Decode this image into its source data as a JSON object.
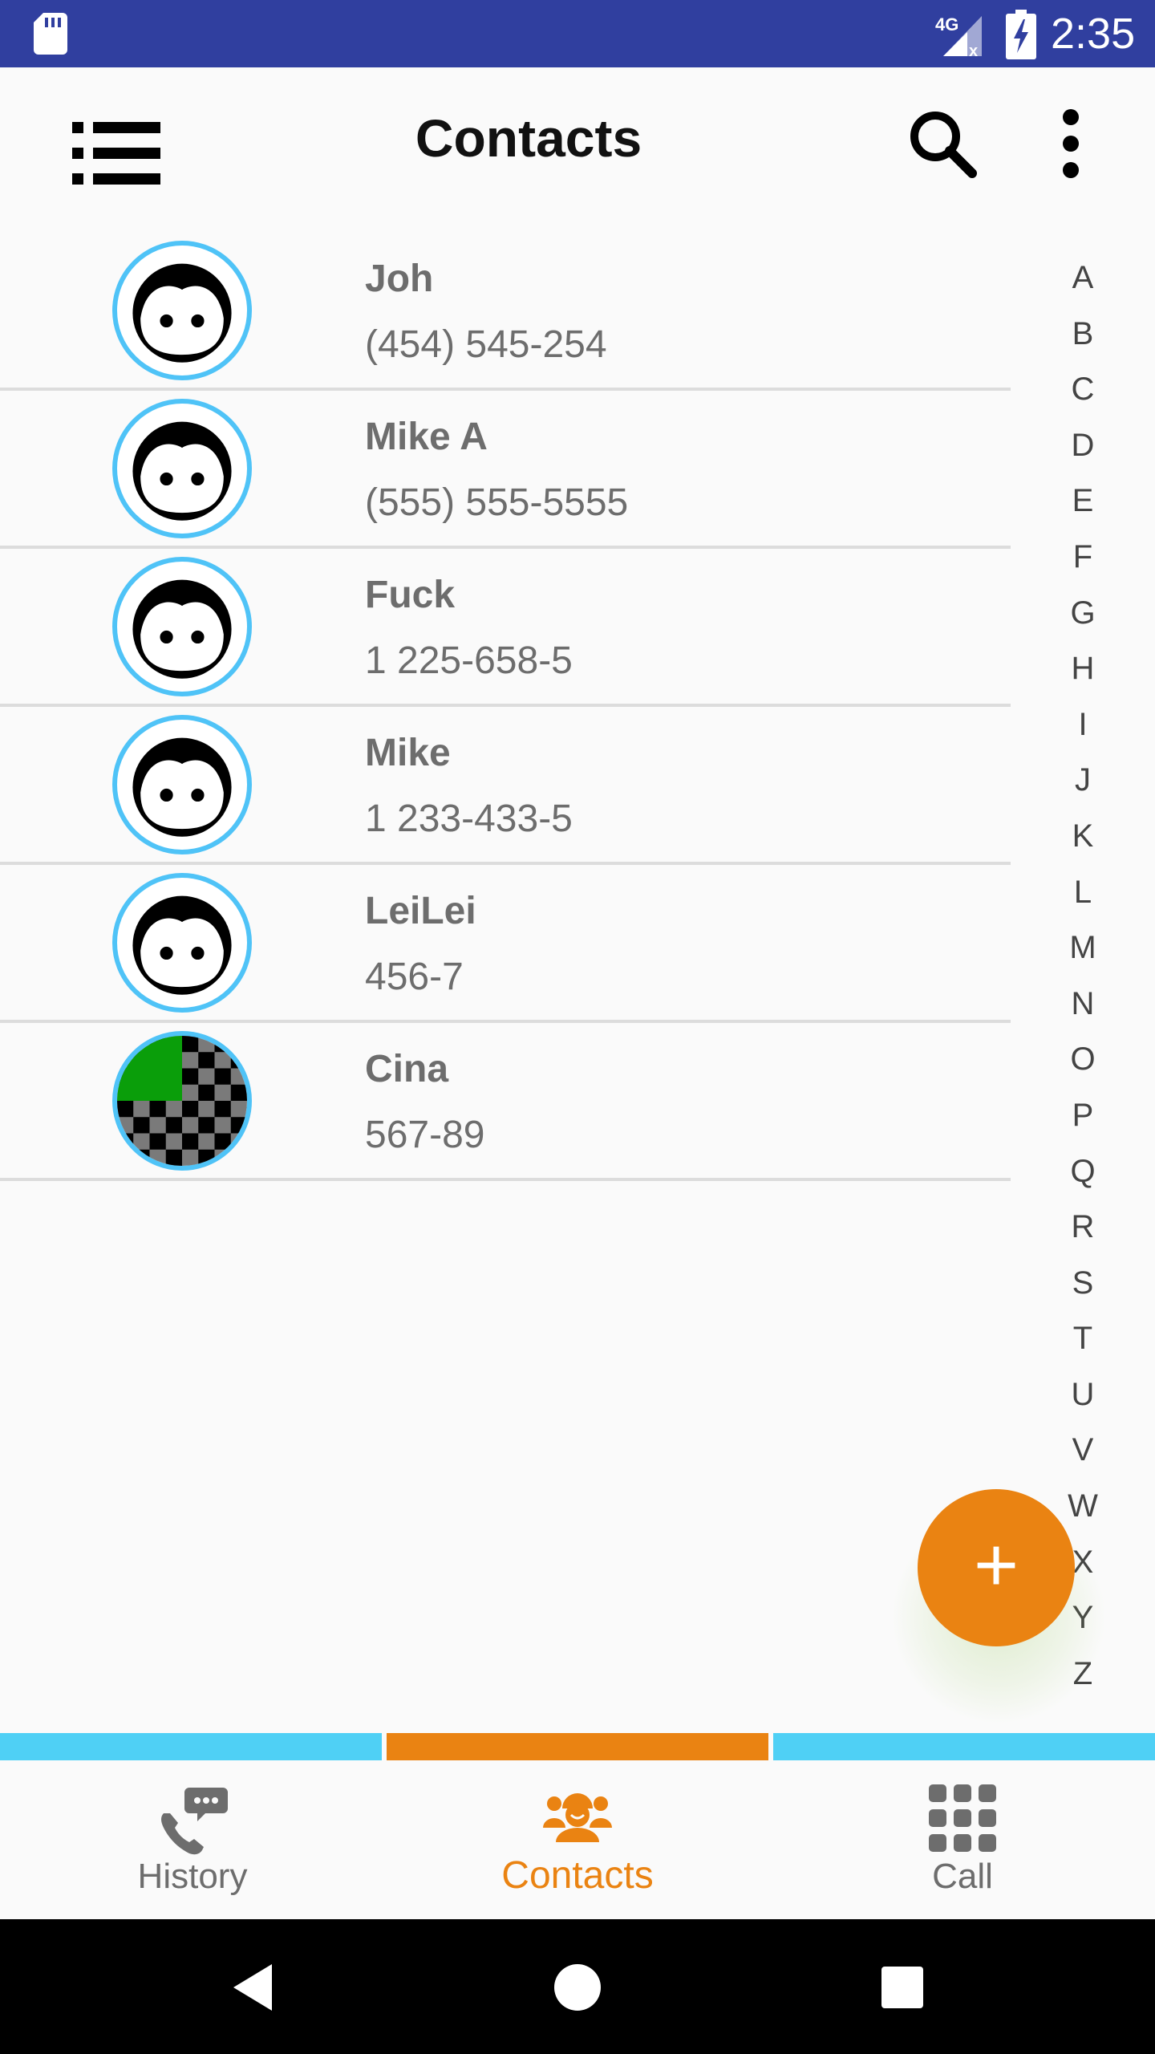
{
  "status_bar": {
    "time": "2:35",
    "network": "4G",
    "icons": [
      "sd-card-icon",
      "signal-icon",
      "battery-charging-icon"
    ]
  },
  "app_bar": {
    "title": "Contacts",
    "icons": [
      "menu-list-icon",
      "search-icon",
      "more-vert-icon"
    ]
  },
  "contacts": [
    {
      "name": "Joh",
      "phone": "(454) 545-254",
      "avatar": "face-icon"
    },
    {
      "name": "Mike A",
      "phone": "(555) 555-5555",
      "avatar": "face-icon"
    },
    {
      "name": "Fuck",
      "phone": "1 225-658-5",
      "avatar": "face-icon"
    },
    {
      "name": "Mike",
      "phone": "1 233-433-5",
      "avatar": "face-icon"
    },
    {
      "name": "LeiLei",
      "phone": "456-7",
      "avatar": "face-icon"
    },
    {
      "name": "Cina",
      "phone": "567-89",
      "avatar": "checker-image"
    }
  ],
  "alphabet": [
    "A",
    "B",
    "C",
    "D",
    "E",
    "F",
    "G",
    "H",
    "I",
    "J",
    "K",
    "L",
    "M",
    "N",
    "O",
    "P",
    "Q",
    "R",
    "S",
    "T",
    "U",
    "V",
    "W",
    "X",
    "Y",
    "Z"
  ],
  "fab": {
    "label": "+"
  },
  "bottom_nav": {
    "tabs": [
      {
        "label": "History",
        "icon": "phone-chat-icon",
        "active": false
      },
      {
        "label": "Contacts",
        "icon": "group-icon",
        "active": true
      },
      {
        "label": "Call",
        "icon": "dialpad-icon",
        "active": false
      }
    ]
  },
  "colors": {
    "status_bar": "#303f9f",
    "accent": "#ea8312",
    "inactive_indicator": "#4fd0f5",
    "avatar_ring": "#4fc3f7",
    "text_secondary": "#6d6d6d"
  }
}
